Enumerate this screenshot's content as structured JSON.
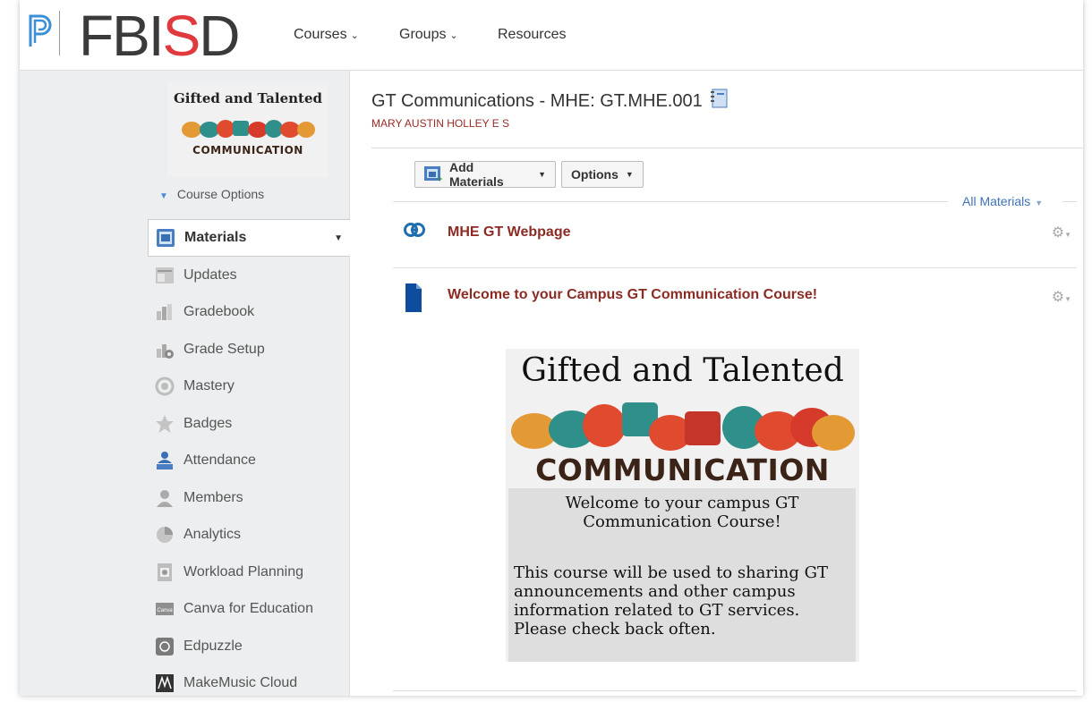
{
  "header": {
    "logo_text_a": "FBI",
    "logo_text_s": "S",
    "logo_text_b": "D",
    "nav": [
      {
        "label": "Courses",
        "has_menu": true
      },
      {
        "label": "Groups",
        "has_menu": true
      },
      {
        "label": "Resources",
        "has_menu": false
      }
    ]
  },
  "sidebar": {
    "course_image": {
      "title": "Gifted and Talented",
      "caption": "COMMUNICATION"
    },
    "course_options_label": "Course Options",
    "items": [
      {
        "label": "Materials",
        "icon": "materials-icon"
      },
      {
        "label": "Updates",
        "icon": "updates-icon"
      },
      {
        "label": "Gradebook",
        "icon": "gradebook-icon"
      },
      {
        "label": "Grade Setup",
        "icon": "grade-setup-icon"
      },
      {
        "label": "Mastery",
        "icon": "mastery-icon"
      },
      {
        "label": "Badges",
        "icon": "badges-icon"
      },
      {
        "label": "Attendance",
        "icon": "attendance-icon"
      },
      {
        "label": "Members",
        "icon": "members-icon"
      },
      {
        "label": "Analytics",
        "icon": "analytics-icon"
      },
      {
        "label": "Workload Planning",
        "icon": "workload-icon"
      },
      {
        "label": "Canva for Education",
        "icon": "canva-icon"
      },
      {
        "label": "Edpuzzle",
        "icon": "edpuzzle-icon"
      },
      {
        "label": "MakeMusic Cloud",
        "icon": "makemusic-icon"
      }
    ]
  },
  "main": {
    "title": "GT Communications - MHE: GT.MHE.001",
    "subtitle": "MARY AUSTIN HOLLEY E S",
    "add_materials_label": "Add Materials",
    "options_label": "Options",
    "all_materials_label": "All Materials",
    "materials": [
      {
        "title": "MHE GT Webpage",
        "icon": "link-icon"
      },
      {
        "title": "Welcome to your Campus GT Communication Course!",
        "icon": "page-icon"
      }
    ],
    "welcome_image": {
      "title": "Gifted and Talented",
      "banner": "COMMUNICATION",
      "line1": "Welcome to your campus GT",
      "line2": "Communication Course!",
      "body1": "This course will be used to sharing GT",
      "body2": "announcements and other campus",
      "body3": "information related to GT services.",
      "body4": "Please check back often."
    }
  },
  "colors": {
    "accent_link": "#3d72b8",
    "material_title": "#8b2b24",
    "school_name": "#9b2a25",
    "logo_red": "#e03a3e",
    "sidebar_bg": "#eceeef"
  }
}
